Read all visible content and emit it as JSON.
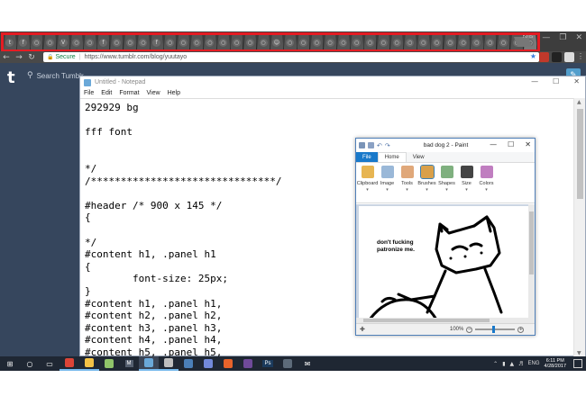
{
  "browser": {
    "tabs": [
      "t",
      "f",
      "○",
      "○",
      "V",
      "○",
      "○",
      "f",
      "○",
      "○",
      "○",
      "f",
      "○",
      "○",
      "○",
      "○",
      "○",
      "○",
      "○",
      "○",
      "☺",
      "○",
      "○",
      "○",
      "○",
      "○",
      "○",
      "○",
      "○",
      "○",
      "○",
      "○",
      "○",
      "○",
      "○",
      "○",
      "○",
      "○",
      "○",
      "○"
    ],
    "active_tab_index": 39,
    "window_user": "Kris",
    "address": {
      "secure_label": "Secure",
      "url": "https://www.tumblr.com/blog/yuutayo"
    }
  },
  "tumblr": {
    "logo": "t",
    "search_placeholder": "Search Tumblr",
    "compose_icon": "✎"
  },
  "notepad": {
    "title": "Untitled - Notepad",
    "menu": [
      "File",
      "Edit",
      "Format",
      "View",
      "Help"
    ],
    "lines": [
      "292929 bg",
      "",
      "fff font",
      "",
      "",
      "*/",
      "/*******************************/",
      "",
      "#header /* 900 x 145 */",
      "{",
      "",
      "*/",
      "#content h1, .panel h1",
      "{",
      "        font-size: 25px;",
      "}",
      "#content h1, .panel h1,",
      "#content h2, .panel h2,",
      "#content h3, .panel h3,",
      "#content h4, .panel h4,",
      "#content h5, .panel h5,"
    ]
  },
  "paint": {
    "title": "bad dog 2 - Paint",
    "tabs": [
      "File",
      "Home",
      "View"
    ],
    "groups": [
      {
        "label": "Clipboard",
        "color": "#e7b552"
      },
      {
        "label": "Image",
        "color": "#9ab8d8"
      },
      {
        "label": "Tools",
        "color": "#e0a87a"
      },
      {
        "label": "Brushes",
        "color": "#d9a04a"
      },
      {
        "label": "Shapes",
        "color": "#7fb07f"
      },
      {
        "label": "Size",
        "color": "#444444"
      },
      {
        "label": "Colors",
        "color": "#c07ec0"
      }
    ],
    "selected_group_index": 3,
    "caption": "don't fucking\npatronize me.",
    "zoom": "100%",
    "zoom_level_fraction": 0.45
  },
  "taskbar": {
    "apps": [
      {
        "icon": "windows-logo-icon",
        "glyph": "⊞",
        "color": "#ffffff"
      },
      {
        "icon": "search-icon",
        "glyph": "○",
        "color": "#ffffff"
      },
      {
        "icon": "task-view-icon",
        "glyph": "▭",
        "color": "#ffffff"
      },
      {
        "icon": "chrome-icon",
        "glyph": "",
        "color": "#db4437",
        "running": true
      },
      {
        "icon": "file-explorer-icon",
        "glyph": "",
        "color": "#f3c246",
        "running": true
      },
      {
        "icon": "notepad-plus-icon",
        "glyph": "",
        "color": "#8fc46a"
      },
      {
        "icon": "m-app-icon",
        "glyph": "M",
        "color": "#556070"
      },
      {
        "icon": "notepad-icon",
        "glyph": "",
        "color": "#6aa8d8",
        "active": true
      },
      {
        "icon": "paint-icon",
        "glyph": "",
        "color": "#bfbfbf",
        "running": true
      },
      {
        "icon": "steam-icon",
        "glyph": "",
        "color": "#4b7fb8"
      },
      {
        "icon": "discord-icon",
        "glyph": "",
        "color": "#7289da"
      },
      {
        "icon": "fire-app-icon",
        "glyph": "",
        "color": "#e8632b"
      },
      {
        "icon": "folder-app-icon",
        "glyph": "",
        "color": "#6f4a9a"
      },
      {
        "icon": "photoshop-icon",
        "glyph": "Ps",
        "color": "#1b3a5c"
      },
      {
        "icon": "globe-app-icon",
        "glyph": "",
        "color": "#5d6b7a"
      },
      {
        "icon": "mail-icon",
        "glyph": "✉",
        "color": "#ffffff"
      }
    ],
    "language": "ENG",
    "time": "6:11 PM",
    "date": "4/28/2017"
  }
}
